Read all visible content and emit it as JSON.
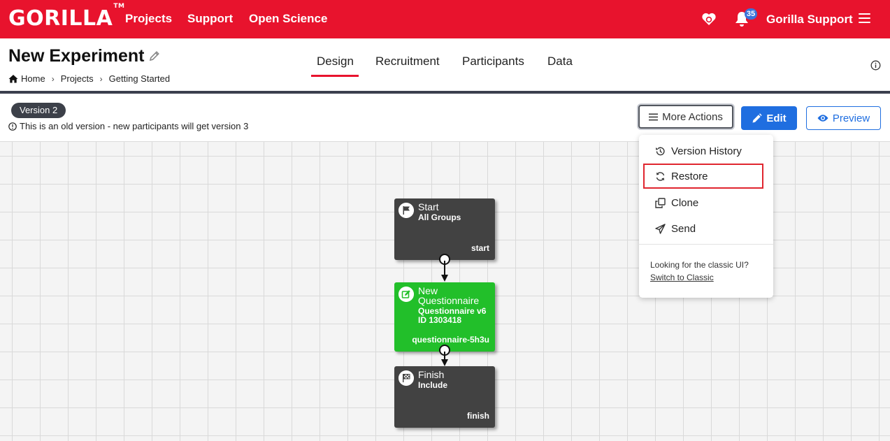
{
  "topbar": {
    "logo": "GORILLA",
    "logo_tm": "TM",
    "nav": [
      "Projects",
      "Support",
      "Open Science"
    ],
    "notification_count": "35",
    "user_name": "Gorilla Support"
  },
  "header": {
    "title": "New Experiment",
    "breadcrumb": [
      "Home",
      "Projects",
      "Getting Started"
    ],
    "tabs": [
      "Design",
      "Recruitment",
      "Participants",
      "Data"
    ],
    "active_tab": "Design"
  },
  "version_bar": {
    "version_label": "Version 2",
    "old_version_note": "This is an old version - new participants will get version 3",
    "more_actions_label": "More Actions",
    "edit_label": "Edit",
    "preview_label": "Preview"
  },
  "dropdown": {
    "items": [
      "Version History",
      "Restore",
      "Clone",
      "Send"
    ],
    "highlighted_item": "Restore",
    "classic_note": "Looking for the classic UI?",
    "classic_link": "Switch to Classic"
  },
  "nodes": [
    {
      "title": "Start",
      "subtitle": [
        "All Groups"
      ],
      "node_id": "start",
      "color": "#424242",
      "icon": "flag-icon"
    },
    {
      "title": "New Questionnaire",
      "title_lines": [
        "New",
        "Questionnaire"
      ],
      "subtitle": [
        "Questionnaire v6",
        "ID 1303418"
      ],
      "node_id": "questionnaire-5h3u",
      "color": "#22bf2a",
      "icon": "edit-icon"
    },
    {
      "title": "Finish",
      "subtitle": [
        "Include"
      ],
      "node_id": "finish",
      "color": "#424242",
      "icon": "checkered-flag-icon"
    }
  ],
  "colors": {
    "brand_red": "#e8132d",
    "primary_blue": "#1f6ee0",
    "node_green": "#22bf2a",
    "node_dark": "#424242",
    "highlight_border": "#e0262f"
  }
}
